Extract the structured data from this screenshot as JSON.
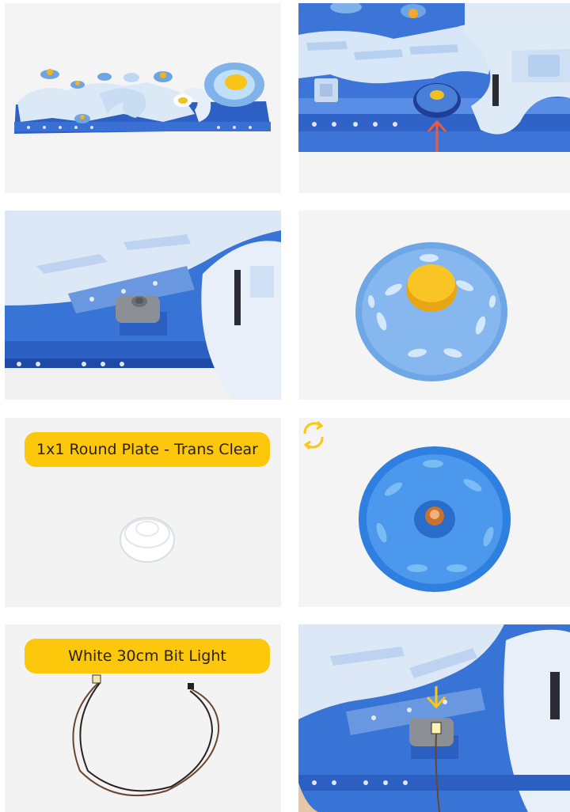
{
  "steps": [
    {
      "id": 1,
      "kind": "photo",
      "subject": "full-build-overview"
    },
    {
      "id": 2,
      "kind": "photo",
      "subject": "locate-planet-piece",
      "indicator": "up-arrow",
      "indicator_color": "#f05a3a"
    },
    {
      "id": 3,
      "kind": "photo",
      "subject": "planet-removed-grey-base"
    },
    {
      "id": 4,
      "kind": "photo",
      "subject": "planet-dish-top-view"
    },
    {
      "id": 5,
      "kind": "part",
      "part_label": "1x1 Round Plate - Trans Clear"
    },
    {
      "id": 6,
      "kind": "photo",
      "subject": "planet-dish-underside",
      "indicator": "rotate-icon",
      "indicator_color": "#fdc70c"
    },
    {
      "id": 7,
      "kind": "part",
      "part_label": "White 30cm Bit Light"
    },
    {
      "id": 8,
      "kind": "photo",
      "subject": "light-installed-on-base",
      "indicator": "down-arrow",
      "indicator_color": "#fdc70c"
    }
  ],
  "colors": {
    "label_bg": "#fdc70c",
    "panel_bg": "#f3f3f4",
    "brick_blue": "#2f63c7",
    "brick_light": "#dce9f7"
  }
}
